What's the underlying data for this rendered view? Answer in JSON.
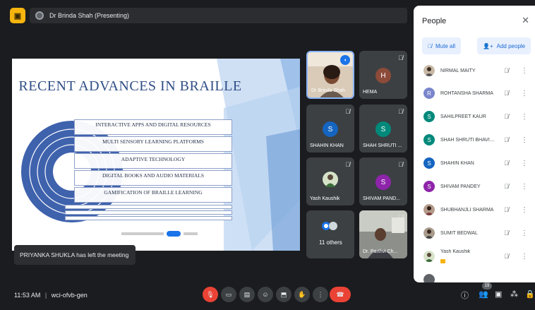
{
  "topbar": {
    "presenter_label": "Dr Brinda Shah (Presenting)"
  },
  "slide": {
    "title": "RECENT ADVANCES IN BRAILLE",
    "items": [
      "INTERACTIVE APPS AND DIGITAL RESOURCES",
      "MULTI SENSORY LEARNING PLATFORMS",
      "ADAPTIVE TECHNOLOGY",
      "DIGITAL BOOKS AND AUDIO MATERIALS",
      "GAMIFICATION OF BRAILLE LEARNING"
    ]
  },
  "toast": {
    "message": "PRIYANKA SHUKLA has left the meeting"
  },
  "tiles": [
    {
      "name": "Dr Brinda Shah",
      "type": "photo",
      "active": true
    },
    {
      "name": "HEMA",
      "initial": "H",
      "color": "#8d4b3a"
    },
    {
      "name": "SHAHIN KHAN",
      "initial": "S",
      "color": "#1565c0"
    },
    {
      "name": "SHAH SHRUTI ...",
      "initial": "S",
      "color": "#00897b"
    },
    {
      "name": "Yash Kaushik",
      "type": "photo"
    },
    {
      "name": "SHIVAM PAND...",
      "initial": "S",
      "color": "#8e24aa"
    },
    {
      "name": "11 others",
      "type": "others"
    },
    {
      "name": "Dr. Parthvi Ch...",
      "type": "photo"
    }
  ],
  "people_panel": {
    "title": "People",
    "mute_all_label": "Mute all",
    "add_people_label": "Add people",
    "participants": [
      {
        "name": "NIRMAL MAITY",
        "avatar": "photo"
      },
      {
        "name": "ROHTANSHA SHARMA",
        "initial": "R",
        "color": "#7986cb"
      },
      {
        "name": "SAHILPREET KAUR",
        "initial": "S",
        "color": "#00897b"
      },
      {
        "name": "SHAH SHRUTI BHAVINK...",
        "initial": "S",
        "color": "#00897b"
      },
      {
        "name": "SHAHIN KHAN",
        "initial": "S",
        "color": "#1565c0"
      },
      {
        "name": "SHIVAM PANDEY",
        "initial": "S",
        "color": "#8e24aa"
      },
      {
        "name": "SHUBHANJLI SHARMA",
        "avatar": "photo"
      },
      {
        "name": "SUMIT BEDWAL",
        "avatar": "photo"
      },
      {
        "name": "Yash Kaushik",
        "avatar": "photo"
      }
    ]
  },
  "bottombar": {
    "time": "11:53 AM",
    "separator": "|",
    "meeting_code": "wci-ofvb-gen",
    "participant_count": "19"
  },
  "colors": {
    "accent_blue": "#1a73e8",
    "hangup_red": "#ea4335",
    "app_yellow": "#f6b40e"
  }
}
